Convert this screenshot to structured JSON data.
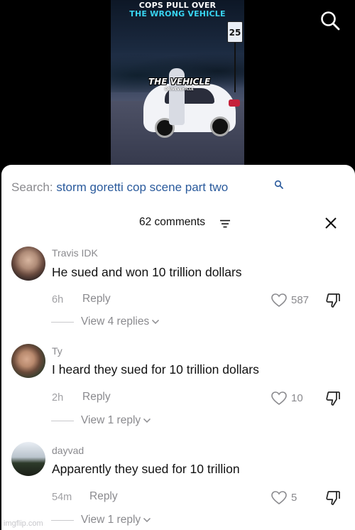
{
  "video": {
    "headline_line1": "COPS PULL OVER",
    "headline_line2": "THE WRONG VEHICLE",
    "sign_text": "25",
    "overlay_text": "THE VEHICLE",
    "overlay_subtext": "DRIVEVEHICLE",
    "search_icon": "search-icon"
  },
  "search": {
    "label": "Search:",
    "term": "storm goretti cop scene part two",
    "icon": "search-icon"
  },
  "comments_header": {
    "count_label": "62 comments",
    "filter_icon": "filter-icon",
    "close_icon": "close-icon"
  },
  "comments": [
    {
      "username": "Travis IDK",
      "text": "He sued and won 10 trillion dollars",
      "time": "6h",
      "reply_label": "Reply",
      "likes": "587",
      "view_replies": "View 4 replies"
    },
    {
      "username": "Ty",
      "text": "I heard they sued for 10 trillion dollars",
      "time": "2h",
      "reply_label": "Reply",
      "likes": "10",
      "view_replies": "View 1 reply"
    },
    {
      "username": "dayvad",
      "text": "Apparently they sued for 10 trillion",
      "time": "54m",
      "reply_label": "Reply",
      "likes": "5",
      "view_replies": "View 1 reply"
    }
  ],
  "watermark": "imgflip.com",
  "colors": {
    "accent_headline": "#38d4f2",
    "search_term": "#2a5a9c",
    "muted_text": "#8a8a8e"
  }
}
